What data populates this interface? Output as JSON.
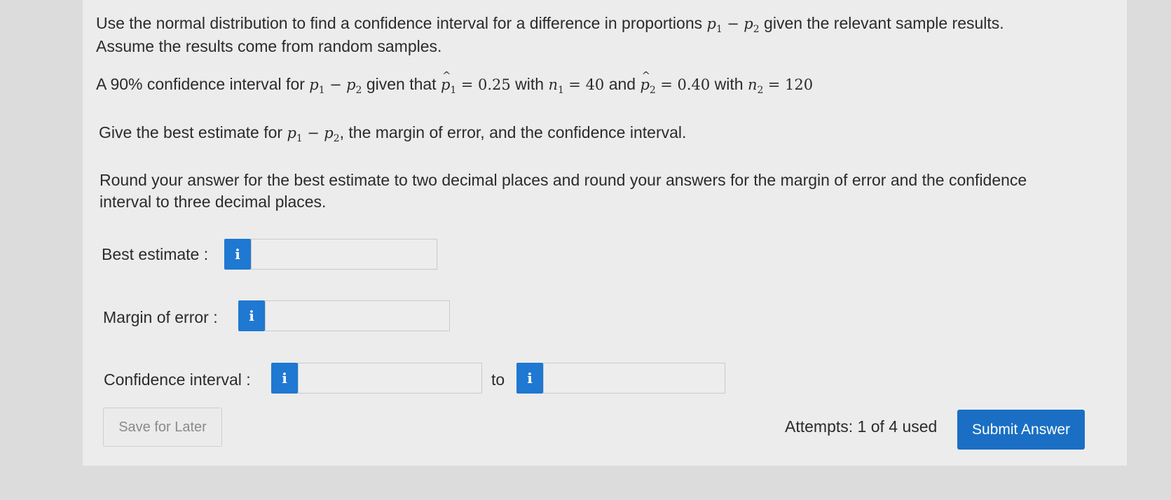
{
  "question": {
    "line1a": "Use the normal distribution to find a confidence interval for a difference in proportions",
    "line1b": "given the relevant sample results.",
    "line2": "Assume the results come from random samples.",
    "ci_prefix": "A 90% confidence interval for",
    "given_that": "given that",
    "p1_value": "= 0.25",
    "with_word": "with",
    "n1_value": "= 40",
    "and_word": "and",
    "p2_value": "= 0.40",
    "n2_value": "= 120",
    "give_prefix": "Give the best estimate for",
    "give_suffix": ", the margin of error, and the confidence interval.",
    "round_line1": "Round your answer for the best estimate to two decimal places and round your answers for the margin of error and the confidence",
    "round_line2": "interval to three decimal places."
  },
  "math": {
    "p": "p",
    "n": "n",
    "minus": "−",
    "sub1": "1",
    "sub2": "2"
  },
  "form": {
    "best_estimate_label": "Best estimate :",
    "margin_label": "Margin of error :",
    "ci_label": "Confidence interval :",
    "to_label": "to",
    "info_glyph": "i",
    "best_estimate_value": "",
    "margin_value": "",
    "ci_lower_value": "",
    "ci_upper_value": ""
  },
  "footer": {
    "save_label": "Save for Later",
    "attempts_text": "Attempts: 1 of 4 used",
    "submit_label": "Submit Answer"
  },
  "colors": {
    "accent": "#1a6fc4",
    "info": "#1f78d1"
  }
}
